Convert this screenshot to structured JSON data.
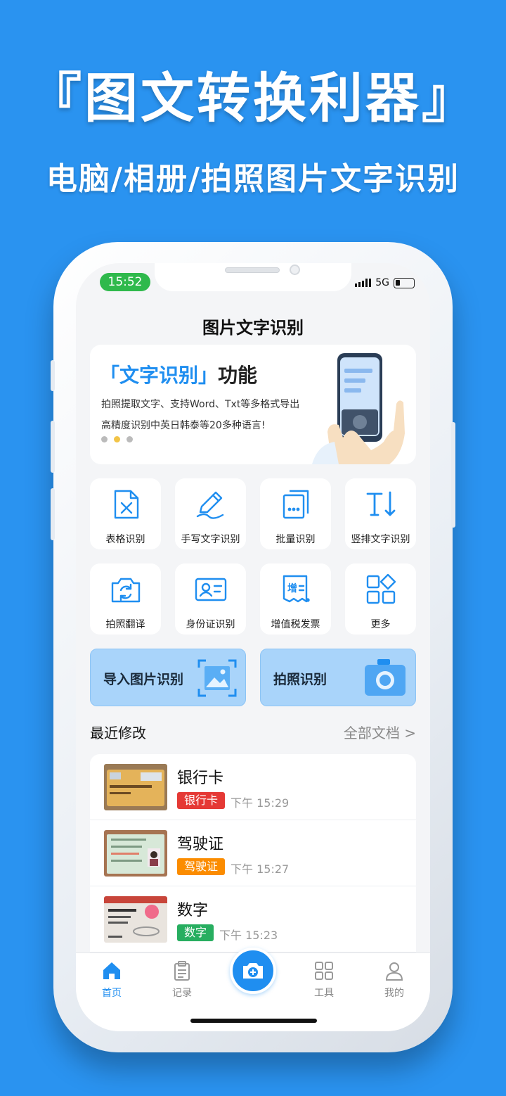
{
  "promo": {
    "headline": "『图文转换利器』",
    "subline": "电脑/相册/拍照图片文字识别"
  },
  "status_bar": {
    "time": "15:52",
    "network": "5G"
  },
  "page": {
    "title": "图片文字识别"
  },
  "banner": {
    "title_prefix": "「文字识别」",
    "title_suffix": "功能",
    "line1": "拍照提取文字、支持Word、Txt等多格式导出",
    "line2": "高精度识别中英日韩泰等20多种语言!",
    "active_dot": 1
  },
  "tools": [
    {
      "label": "表格识别",
      "icon": "excel-file-icon"
    },
    {
      "label": "手写文字识别",
      "icon": "pen-icon"
    },
    {
      "label": "批量识别",
      "icon": "stacked-docs-icon"
    },
    {
      "label": "竖排文字识别",
      "icon": "vertical-text-icon"
    },
    {
      "label": "拍照翻译",
      "icon": "camera-rotate-icon"
    },
    {
      "label": "身份证识别",
      "icon": "id-card-icon"
    },
    {
      "label": "增值税发票",
      "icon": "invoice-icon"
    },
    {
      "label": "更多",
      "icon": "more-grid-icon"
    }
  ],
  "actions": {
    "import_label": "导入图片识别",
    "photo_label": "拍照识别"
  },
  "recent": {
    "title": "最近修改",
    "more": "全部文档 >",
    "items": [
      {
        "title": "银行卡",
        "tag": "银行卡",
        "tag_color": "#e53935",
        "time": "下午 15:29"
      },
      {
        "title": "驾驶证",
        "tag": "驾驶证",
        "tag_color": "#fb8c00",
        "time": "下午 15:27"
      },
      {
        "title": "数字",
        "tag": "数字",
        "tag_color": "#27ae60",
        "time": "下午 15:23"
      }
    ]
  },
  "tabbar": {
    "home": "首页",
    "records": "记录",
    "tools": "工具",
    "mine": "我的"
  },
  "colors": {
    "accent": "#1f8ef0",
    "background": "#2a93f0",
    "action_button": "#a9d4fa"
  }
}
